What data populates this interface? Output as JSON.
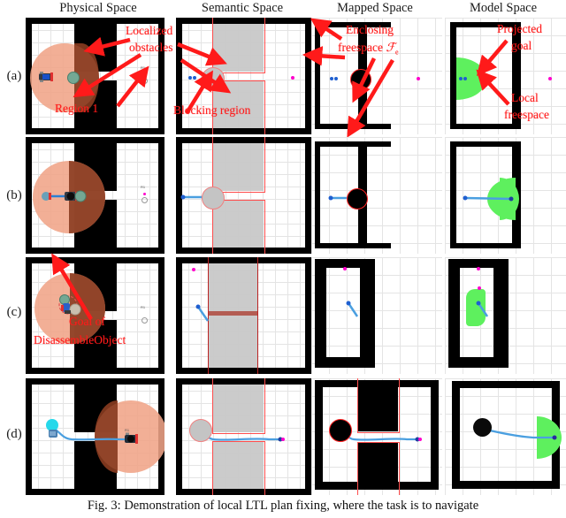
{
  "figure": {
    "caption": "Fig. 3: Demonstration of local LTL plan fixing, where the task is to navigate"
  },
  "columns": [
    {
      "id": "physical",
      "label": "Physical Space"
    },
    {
      "id": "semantic",
      "label": "Semantic Space"
    },
    {
      "id": "mapped",
      "label": "Mapped Space"
    },
    {
      "id": "model",
      "label": "Model Space"
    }
  ],
  "rows": [
    {
      "id": "a",
      "label": "(a)"
    },
    {
      "id": "b",
      "label": "(b)"
    },
    {
      "id": "c",
      "label": "(c)"
    },
    {
      "id": "d",
      "label": "(d)"
    }
  ],
  "annotations": {
    "localized_obstacles_line1": "Localized",
    "localized_obstacles_line2": "obstacles",
    "region_1": "Region 1",
    "blocking_region": "Blocking region",
    "enclosing_freespace_line1": "Enclosing",
    "enclosing_freespace_line2": "freespace",
    "enclosing_freespace_symbol": "ℱ",
    "enclosing_freespace_subscript": "e",
    "projected_goal_line1": "Projected",
    "projected_goal_line2": "goal",
    "local_freespace_line1": "Local",
    "local_freespace_line2": "freespace",
    "goal_line1": "Goal of",
    "goal_line2": "DisassembleObject"
  },
  "region_markers": {
    "r1_label": "R1"
  },
  "colors": {
    "annotation_red": "#ff1a1a",
    "wall_black": "#000000",
    "sensing_disc": "#f0a488",
    "sensing_disc_dark": "#8a3c20",
    "semantic_region_gray": "#c8c8c8",
    "semantic_outline_red": "#ff4d4d",
    "local_freespace_green": "#5ef05e",
    "goal_marker_magenta": "#ff00cc",
    "path_blue": "#4a9fe0",
    "agent_cyan": "#26d8ea"
  },
  "scene": {
    "description_physical": "Top-down occupancy map with two black obstacle blocks forming a corridor gap, white freespace left and right, light grid background",
    "description_semantic": "Abstracted map where obstacles become gray semantic regions outlined in red",
    "description_mapped": "Map built by the robot showing enclosing freespace as black walls and a localized obstacle blob",
    "description_model": "Model space with green local freespace and projected goal marker"
  }
}
